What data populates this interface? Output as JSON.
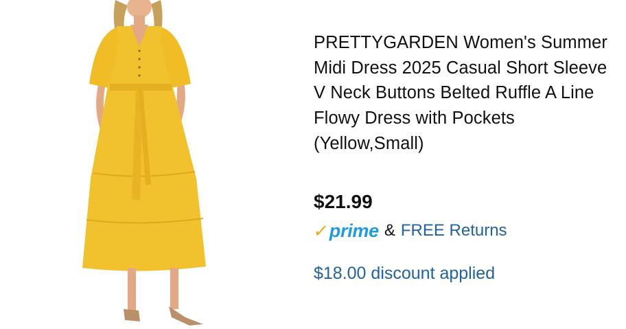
{
  "product": {
    "title": "PRETTYGARDEN Women's Summer Midi Dress 2025 Casual Short Sleeve V Neck Buttons Belted Ruffle A Line Flowy Dress with Pockets (Yellow,Small)",
    "price": "$21.99",
    "prime_label": "prime",
    "ampersand": "&",
    "returns_label": "FREE Returns",
    "discount_text": "$18.00 discount applied"
  },
  "colors": {
    "dress": "#f2c12e",
    "prime_blue": "#1f9ce0",
    "prime_check": "#f7a71a",
    "link_blue": "#2162a1"
  }
}
